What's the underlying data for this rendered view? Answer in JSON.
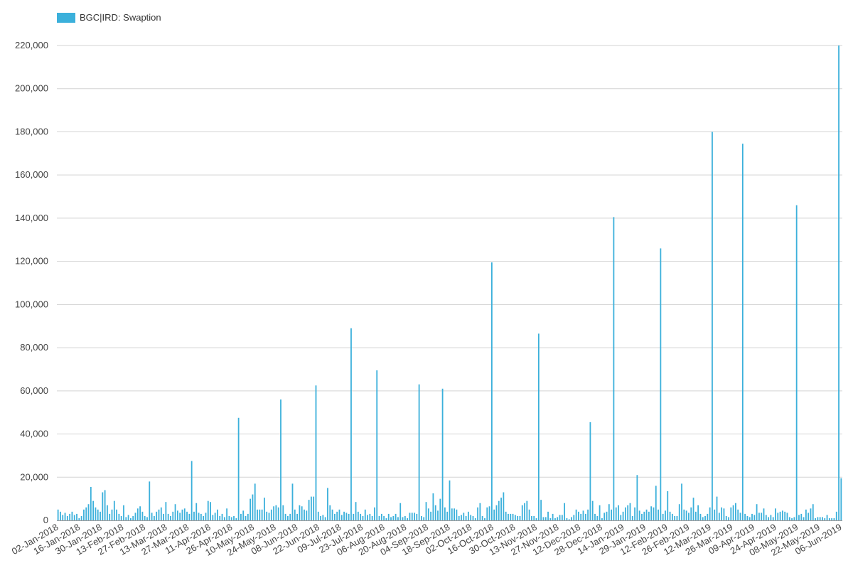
{
  "chart_data": {
    "type": "bar",
    "legend": {
      "label": "BGC|IRD: Swaption",
      "color": "#3bb0db",
      "position": "top-left"
    },
    "ylim": [
      0,
      220000
    ],
    "yticks": [
      "0",
      "20,000",
      "40,000",
      "60,000",
      "80,000",
      "100,000",
      "120,000",
      "140,000",
      "160,000",
      "180,000",
      "200,000",
      "220,000"
    ],
    "x_range": [
      "2018-01-02",
      "2019-06-07"
    ],
    "xticks": [
      "02-Jan-2018",
      "16-Jan-2018",
      "30-Jan-2018",
      "13-Feb-2018",
      "27-Feb-2018",
      "13-Mar-2018",
      "27-Mar-2018",
      "11-Apr-2018",
      "26-Apr-2018",
      "10-May-2018",
      "24-May-2018",
      "08-Jun-2018",
      "22-Jun-2018",
      "09-Jul-2018",
      "23-Jul-2018",
      "06-Aug-2018",
      "20-Aug-2018",
      "04-Sep-2018",
      "18-Sep-2018",
      "02-Oct-2018",
      "16-Oct-2018",
      "30-Oct-2018",
      "13-Nov-2018",
      "27-Nov-2018",
      "12-Dec-2018",
      "28-Dec-2018",
      "14-Jan-2019",
      "29-Jan-2019",
      "12-Feb-2019",
      "26-Feb-2019",
      "12-Mar-2019",
      "26-Mar-2019",
      "09-Apr-2019",
      "24-Apr-2019",
      "08-May-2019",
      "22-May-2019",
      "06-Jun-2019"
    ],
    "grid": true,
    "series": [
      {
        "name": "BGC|IRD: Swaption",
        "values": [
          5000,
          4000,
          2500,
          3500,
          2000,
          3000,
          4000,
          2500,
          3000,
          1000,
          2000,
          5000,
          6000,
          7500,
          15500,
          9000,
          6000,
          5000,
          4000,
          13000,
          14000,
          7000,
          3000,
          5000,
          9000,
          5000,
          3000,
          2000,
          7000,
          1500,
          2500,
          1000,
          2000,
          3500,
          5500,
          6500,
          4000,
          2000,
          1500,
          18000,
          3500,
          2000,
          4000,
          5000,
          6000,
          3000,
          8500,
          3000,
          2000,
          4000,
          7500,
          4500,
          3500,
          5000,
          5500,
          4000,
          3000,
          27500,
          4000,
          8000,
          3500,
          3000,
          2000,
          3500,
          9000,
          8500,
          2500,
          3500,
          5000,
          2000,
          3000,
          1500,
          5500,
          2000,
          1500,
          2000,
          1000,
          47500,
          3000,
          4500,
          2000,
          3000,
          10000,
          12000,
          17000,
          5000,
          5000,
          5000,
          10500,
          4000,
          3500,
          5000,
          6500,
          7000,
          6000,
          56000,
          7000,
          3000,
          2000,
          3000,
          17000,
          5000,
          3000,
          7000,
          6500,
          5000,
          4500,
          9500,
          11000,
          11000,
          62500,
          4000,
          2000,
          2500,
          1500,
          15000,
          7000,
          5000,
          3000,
          4000,
          5000,
          2500,
          4000,
          3500,
          3000,
          89000,
          3000,
          8500,
          4000,
          3000,
          2000,
          5000,
          2500,
          3000,
          2000,
          6000,
          69500,
          2000,
          3000,
          2000,
          1000,
          3000,
          1500,
          2000,
          3000,
          1500,
          8000,
          1500,
          2000,
          1000,
          3500,
          3500,
          3500,
          3000,
          63000,
          2000,
          1500,
          8500,
          5500,
          4000,
          12500,
          7000,
          4500,
          10000,
          61000,
          6000,
          4000,
          18500,
          5500,
          5500,
          5000,
          2000,
          2500,
          3500,
          2000,
          4000,
          2500,
          2000,
          1000,
          6000,
          8000,
          2000,
          1000,
          6000,
          6500,
          119500,
          5000,
          7000,
          9000,
          10500,
          13000,
          4000,
          3000,
          3000,
          3000,
          2500,
          2000,
          2000,
          7000,
          8000,
          9000,
          5000,
          2000,
          2000,
          1000,
          86500,
          9500,
          1500,
          1500,
          4000,
          1000,
          3000,
          1000,
          1500,
          2500,
          2500,
          8000,
          1000,
          500,
          1500,
          2500,
          5000,
          4000,
          3000,
          4500,
          3000,
          5000,
          45500,
          9000,
          3000,
          2000,
          7000,
          1000,
          3500,
          4000,
          7500,
          5000,
          140500,
          6000,
          7000,
          2500,
          4000,
          6000,
          7000,
          8000,
          2000,
          6000,
          21000,
          4500,
          3000,
          4000,
          5000,
          4000,
          6500,
          6000,
          16000,
          5000,
          126000,
          3000,
          4500,
          13500,
          4000,
          3000,
          2000,
          2000,
          7500,
          17000,
          5000,
          4500,
          3500,
          6000,
          10500,
          4000,
          7000,
          3000,
          1500,
          2000,
          3000,
          6000,
          180000,
          5000,
          11000,
          3500,
          6000,
          5500,
          2000,
          1500,
          6000,
          7000,
          8000,
          5000,
          3500,
          174500,
          3000,
          2000,
          1500,
          3000,
          2500,
          7500,
          3500,
          3500,
          5500,
          2500,
          1500,
          2500,
          1500,
          5500,
          3500,
          4000,
          4500,
          4000,
          3500,
          1500,
          1000,
          1500,
          146000,
          2500,
          3000,
          1500,
          5000,
          3500,
          5500,
          7500,
          1000,
          1500,
          1500,
          1500,
          1000,
          2500,
          1000,
          1000,
          1000,
          4000,
          220000,
          19500
        ]
      }
    ]
  }
}
